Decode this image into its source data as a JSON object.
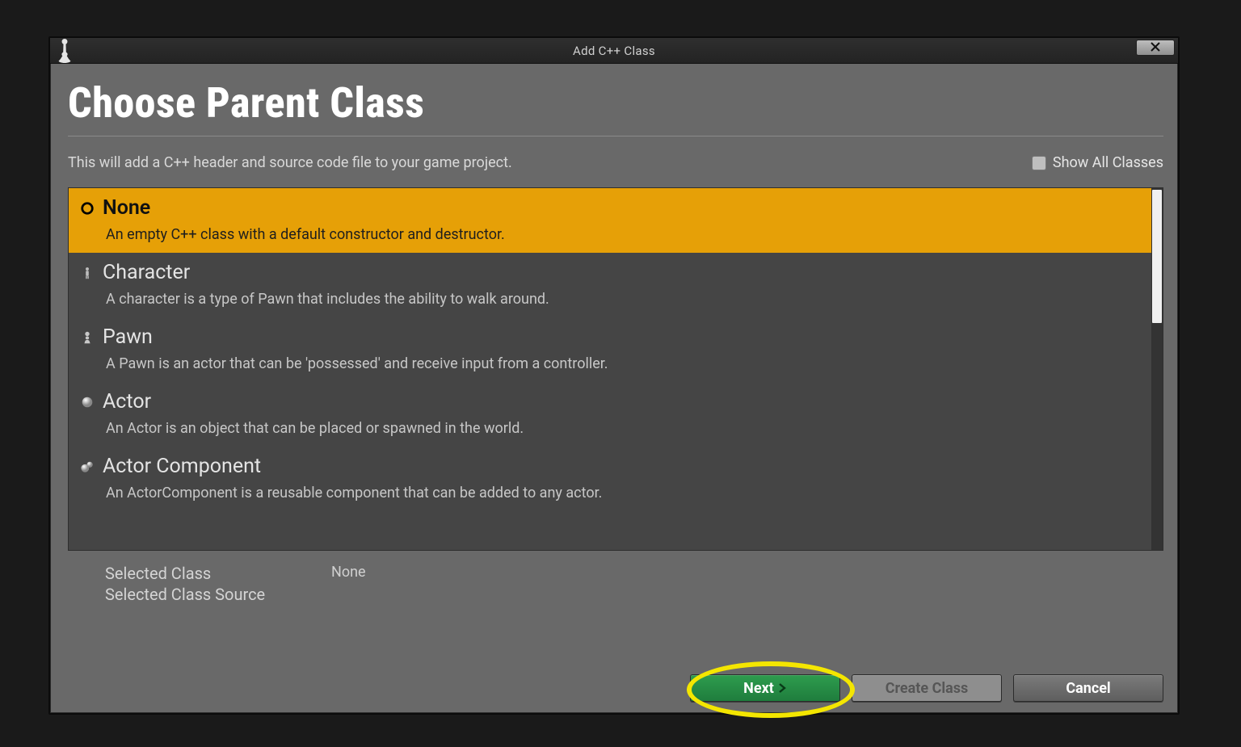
{
  "titlebar": {
    "title": "Add C++ Class",
    "close_label": "×"
  },
  "heading": "Choose Parent Class",
  "subtext": "This will add a C++ header and source code file to your game project.",
  "show_all": {
    "label": "Show All Classes",
    "checked": false
  },
  "items": [
    {
      "name": "None",
      "desc": "An empty C++ class with a default constructor and destructor."
    },
    {
      "name": "Character",
      "desc": "A character is a type of Pawn that includes the ability to walk around."
    },
    {
      "name": "Pawn",
      "desc": "A Pawn is an actor that can be 'possessed' and receive input from a controller."
    },
    {
      "name": "Actor",
      "desc": "An Actor is an object that can be placed or spawned in the world."
    },
    {
      "name": "Actor Component",
      "desc": "An ActorComponent is a reusable component that can be added to any actor."
    }
  ],
  "selected_index": 0,
  "selected": {
    "class_label": "Selected Class",
    "class_value": "None",
    "source_label": "Selected Class Source",
    "source_value": ""
  },
  "buttons": {
    "next": "Next",
    "create": "Create Class",
    "cancel": "Cancel"
  }
}
